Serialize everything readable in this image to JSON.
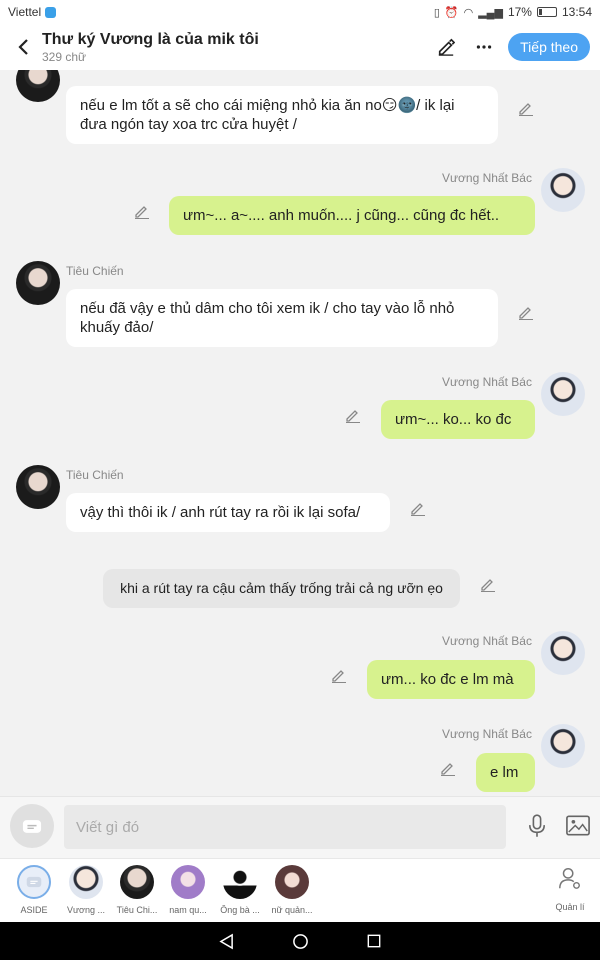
{
  "status": {
    "carrier": "Viettel",
    "battery": "17%",
    "time": "13:54"
  },
  "header": {
    "title": "Thư ký Vương là của mik tôi",
    "subtitle": "329 chữ",
    "next_label": "Tiếp theo"
  },
  "messages": [
    {
      "side": "left",
      "name": "Tiêu Chiến",
      "text": "nếu e lm tốt a sẽ cho cái miệng nhỏ kia ăn no😏🌚/ ik lại đưa ngón tay xoa trc cửa huyệt /"
    },
    {
      "side": "right",
      "name": "Vương Nhất Bác",
      "text": "ưm~... a~.... anh muốn.... j cũng... cũng đc hết.."
    },
    {
      "side": "left",
      "name": "Tiêu Chiến",
      "text": "nếu đã vậy e thủ dâm cho tôi xem ik / cho tay vào lỗ nhỏ khuấy đảo/"
    },
    {
      "side": "right",
      "name": "Vương Nhất Bác",
      "text": "ưm~... ko... ko đc"
    },
    {
      "side": "left",
      "name": "Tiêu Chiến",
      "text": "vậy thì thôi ik / anh rút tay ra rồi ik lại sofa/"
    },
    {
      "side": "narration",
      "text": "khi a rút tay ra cậu cảm thấy trống trải cả ng ưỡn ẹo"
    },
    {
      "side": "right",
      "name": "Vương Nhất Bác",
      "text": "ưm... ko đc e lm mà"
    },
    {
      "side": "right",
      "name": "Vương Nhất Bác",
      "text": "e lm"
    }
  ],
  "input": {
    "placeholder": "Viết gì đó"
  },
  "characters": [
    {
      "label": "ASIDE",
      "icon": "aside-icon"
    },
    {
      "label": "Vương ...",
      "icon": "avatar-vuong"
    },
    {
      "label": "Tiêu Chi...",
      "icon": "avatar-tieu"
    },
    {
      "label": "nam qu...",
      "icon": "avatar-nam"
    },
    {
      "label": "Ông bà ...",
      "icon": "avatar-ong-ba"
    },
    {
      "label": "nữ quản...",
      "icon": "avatar-nu-quan"
    }
  ],
  "manage_label": "Quản lí"
}
